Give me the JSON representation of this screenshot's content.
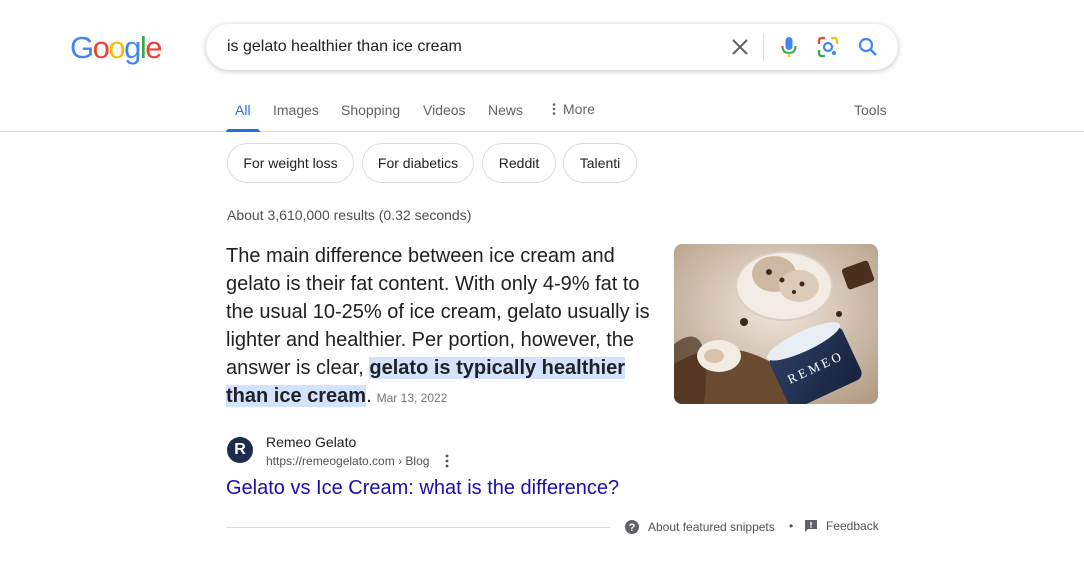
{
  "logo": {
    "letters": [
      "G",
      "o",
      "o",
      "g",
      "l",
      "e"
    ],
    "colors": [
      "#4285F4",
      "#EA4335",
      "#FBBC05",
      "#4285F4",
      "#34A853",
      "#EA4335"
    ]
  },
  "search": {
    "query": "is gelato healthier than ice cream",
    "icons": [
      "close-icon",
      "microphone-icon",
      "lens-camera-icon",
      "search-icon"
    ]
  },
  "tabs": {
    "items": [
      {
        "label": "All",
        "active": true
      },
      {
        "label": "Images"
      },
      {
        "label": "Shopping"
      },
      {
        "label": "Videos"
      },
      {
        "label": "News"
      },
      {
        "label": "More",
        "icon": "kebab-vertical-icon"
      }
    ],
    "tools_label": "Tools"
  },
  "chips": [
    "For weight loss",
    "For diabetics",
    "Reddit",
    "Talenti"
  ],
  "result_stats": "About 3,610,000 results (0.32 seconds)",
  "featured_snippet": {
    "text_plain": "The main difference between ice cream and gelato is their fat content. With only 4-9% fat to the usual 10-25% of ice cream, gelato usually is lighter and healthier. Per portion, however, the answer is clear, ",
    "text_highlight": "gelato is typically healthier than ice cream",
    "text_end": ".",
    "date": "Mar 13, 2022",
    "image_label": "REMEO"
  },
  "source": {
    "icon_letter": "R",
    "name": "Remeo Gelato",
    "url": "https://remeogelato.com › Blog",
    "title": "Gelato vs Ice Cream: what is the difference?"
  },
  "footer": {
    "about_label": "About featured snippets",
    "separator": "•",
    "feedback_label": "Feedback"
  },
  "accent": "#1a73e8",
  "link_color": "#1a0dab",
  "highlight_color": "#d3e3fd"
}
